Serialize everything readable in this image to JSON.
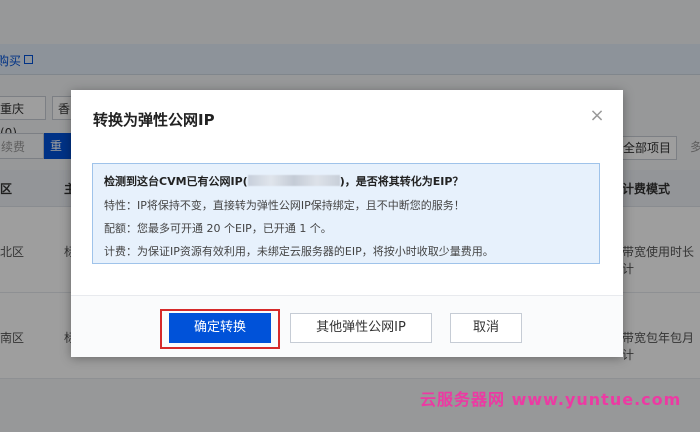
{
  "background": {
    "top_link": "购买",
    "filters": [
      "重庆(0)",
      "香"
    ],
    "renew_btn": "续费",
    "blue_btn": "重",
    "project_select": "全部项目",
    "project_more": "多",
    "table_headers": [
      "区",
      "主",
      "计费模式"
    ],
    "rows": [
      {
        "region": "北区",
        "col2": "标",
        "billing": "带宽使用时长计"
      },
      {
        "region": "南区",
        "col2": "标",
        "billing": "带宽包年包月计"
      }
    ]
  },
  "dialog": {
    "title": "转换为弹性公网IP",
    "close_glyph": "×",
    "question_pre": "检测到这台CVM已有公网IP(",
    "question_post": ")，是否将其转化为EIP？",
    "feature": "特性：IP将保持不变，直接转为弹性公网IP保持绑定，且不中断您的服务！",
    "quota": "配额：您最多可开通 20 个EIP，已开通 1 个。",
    "billing": "计费：为保证IP资源有效利用，未绑定云服务器的EIP，将按小时收取少量费用。",
    "buttons": {
      "confirm": "确定转换",
      "other": "其他弹性公网IP",
      "cancel": "取消"
    }
  },
  "watermark": "云服务器网 www.yuntue.com",
  "colors": {
    "primary": "#0052d9",
    "info_bg": "#e7f1fc",
    "info_border": "#9fc3ea",
    "highlight": "#d62a2a",
    "watermark": "#ec3aa3"
  }
}
